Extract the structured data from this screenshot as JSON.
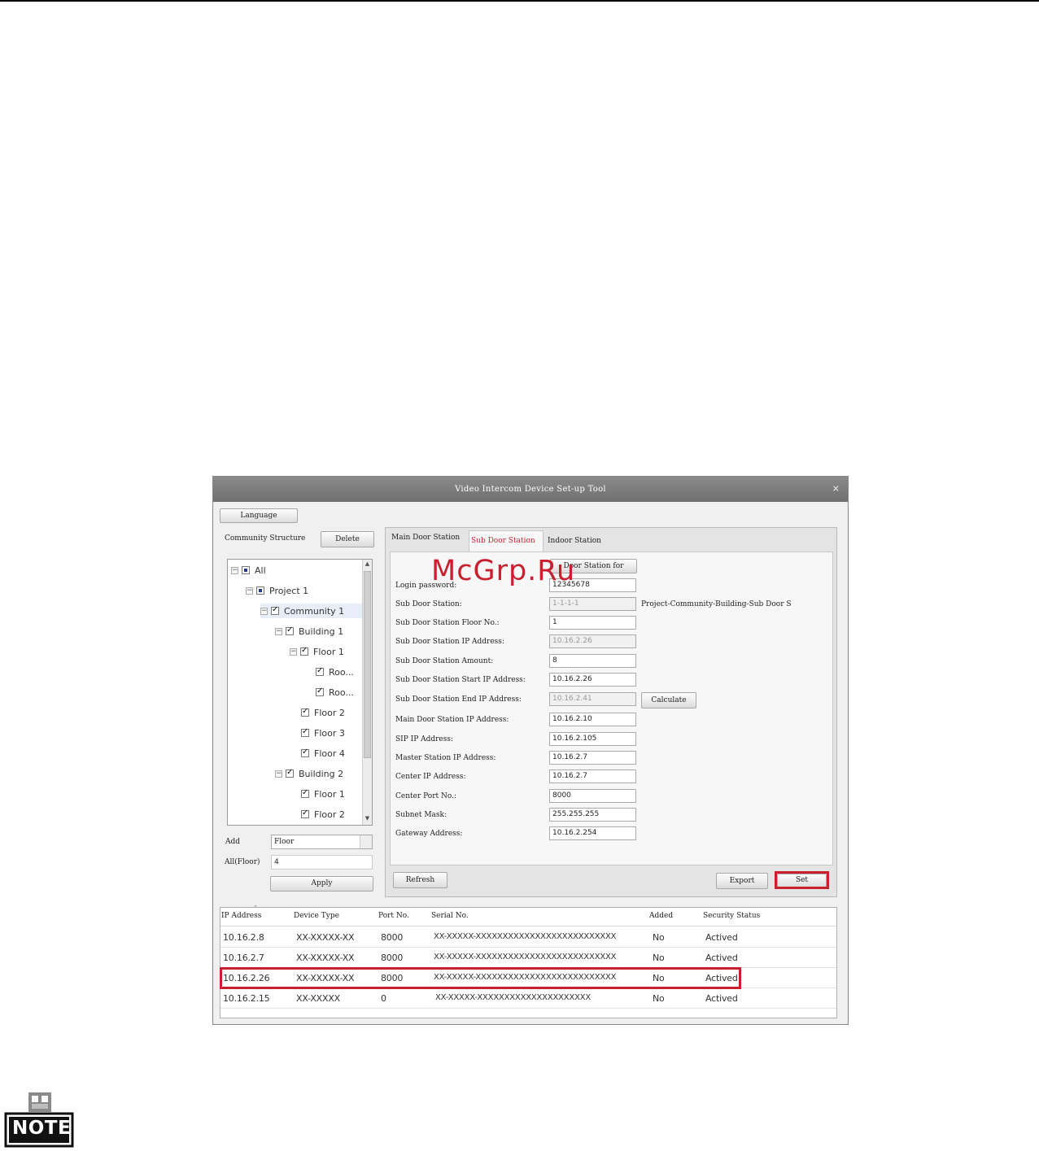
{
  "window": {
    "title": "Video Intercom Device Set-up Tool",
    "close": "×"
  },
  "toolbar": {
    "language": "Language"
  },
  "community": {
    "label": "Community Structure",
    "delete": "Delete",
    "tree": [
      {
        "label": "All",
        "state": "partial",
        "expander": "−"
      },
      {
        "label": "Project 1",
        "state": "partial",
        "expander": "−"
      },
      {
        "label": "Community 1",
        "state": "checked",
        "expander": "−"
      },
      {
        "label": "Building 1",
        "state": "checked",
        "expander": "−"
      },
      {
        "label": "Floor 1",
        "state": "checked",
        "expander": "−"
      },
      {
        "label": "Roo...",
        "state": "checked"
      },
      {
        "label": "Roo...",
        "state": "checked"
      },
      {
        "label": "Floor 2",
        "state": "checked"
      },
      {
        "label": "Floor 3",
        "state": "checked"
      },
      {
        "label": "Floor 4",
        "state": "checked"
      },
      {
        "label": "Building 2",
        "state": "checked",
        "expander": "−"
      },
      {
        "label": "Floor 1",
        "state": "checked"
      },
      {
        "label": "Floor 2",
        "state": "checked"
      }
    ],
    "add_label": "Add",
    "add_select": "Floor",
    "all_floor_label": "All(Floor)",
    "all_floor_value": "4",
    "apply": "Apply"
  },
  "tabs": [
    {
      "label": "Main Door Station",
      "active": false
    },
    {
      "label": "Sub Door Station",
      "active": true
    },
    {
      "label": "Indoor Station",
      "active": false
    }
  ],
  "form": {
    "door_station_for": "Door Station for",
    "fields": [
      {
        "label": "Login password:",
        "value": "12345678",
        "disabled": false
      },
      {
        "label": "Sub Door Station:",
        "value": "1-1-1-1",
        "disabled": true,
        "suffix": "Project-Community-Building-Sub Door S"
      },
      {
        "label": "Sub Door Station Floor No.:",
        "value": "1",
        "disabled": false
      },
      {
        "label": "Sub Door Station IP Address:",
        "value": "10.16.2.26",
        "disabled": true
      },
      {
        "label": "Sub Door Station Amount:",
        "value": "8",
        "disabled": false
      },
      {
        "label": "Sub Door Station Start IP Address:",
        "value": "10.16.2.26",
        "disabled": false
      },
      {
        "label": "Sub Door Station End IP Address:",
        "value": "10.16.2.41",
        "disabled": true
      },
      {
        "label": "Main Door Station IP Address:",
        "value": "10.16.2.10",
        "disabled": false
      },
      {
        "label": "SIP IP Address:",
        "value": "10.16.2.105",
        "disabled": false
      },
      {
        "label": "Master Station IP Address:",
        "value": "10.16.2.7",
        "disabled": false
      },
      {
        "label": "Center IP Address:",
        "value": "10.16.2.7",
        "disabled": false
      },
      {
        "label": "Center Port No.:",
        "value": "8000",
        "disabled": false
      },
      {
        "label": "Subnet Mask:",
        "value": "255.255.255",
        "disabled": false
      },
      {
        "label": "Gateway Address:",
        "value": "10.16.2.254",
        "disabled": false
      }
    ],
    "calculate": "Calculate",
    "refresh": "Refresh",
    "export": "Export",
    "set": "Set"
  },
  "devices": {
    "headers": [
      "IP Address",
      "Device Type",
      "Port No.",
      "Serial No.",
      "Added",
      "Security Status"
    ],
    "rows": [
      [
        "10.16.2.8",
        "XX-XXXXX-XX",
        "8000",
        "XX-XXXXX-XXXXXXXXXXXXXXXXXXXXXXXXXX",
        "No",
        "Actived"
      ],
      [
        "10.16.2.7",
        "XX-XXXXX-XX",
        "8000",
        "XX-XXXXX-XXXXXXXXXXXXXXXXXXXXXXXXXX",
        "No",
        "Actived"
      ],
      [
        "10.16.2.26",
        "XX-XXXXX-XX",
        "8000",
        "XX-XXXXX-XXXXXXXXXXXXXXXXXXXXXXXXXX",
        "No",
        "Actived"
      ],
      [
        "10.16.2.15",
        "XX-XXXXX",
        "0",
        "XX-XXXXX-XXXXXXXXXXXXXXXXXXXXX",
        "No",
        "Actived"
      ]
    ]
  },
  "watermark": "McGrp.Ru",
  "note": {
    "label": "NOTE"
  },
  "colors": {
    "highlight": "#c8202f",
    "titlebar": "#7d7d7d"
  }
}
